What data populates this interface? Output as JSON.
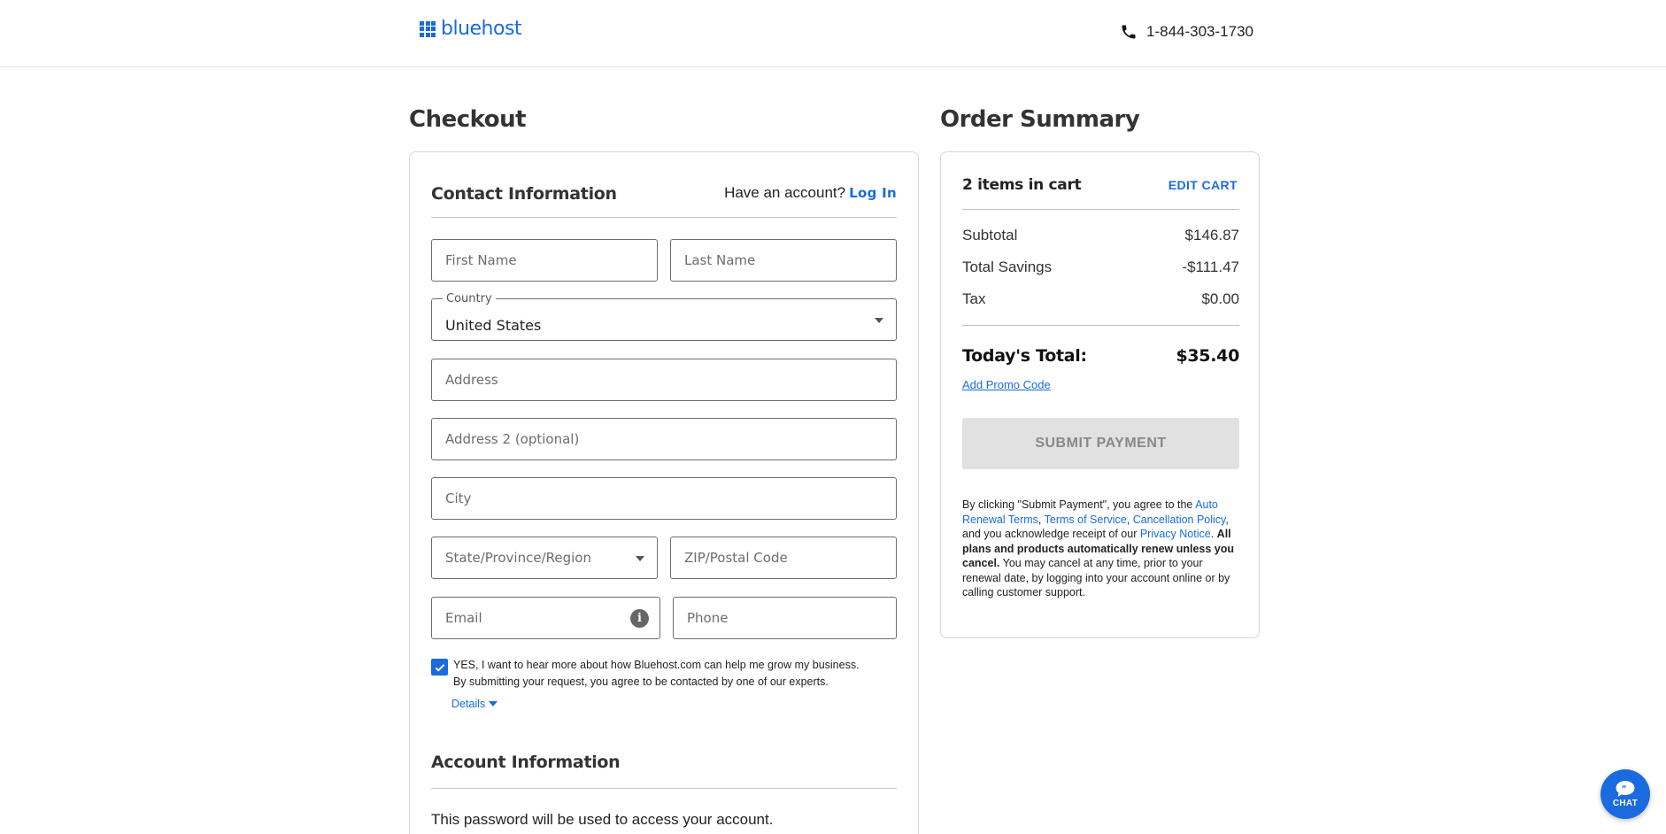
{
  "header": {
    "logo_text": "bluehost",
    "phone": "1-844-303-1730"
  },
  "checkout": {
    "title": "Checkout",
    "contact": {
      "title": "Contact Information",
      "have_account": "Have an account?",
      "login_label": "Log In"
    },
    "fields": {
      "first_name": "First Name",
      "last_name": "Last Name",
      "country_label": "Country",
      "country_value": "United States",
      "address": "Address",
      "address2": "Address 2 (optional)",
      "city": "City",
      "state": "State/Province/Region",
      "zip": "ZIP/Postal Code",
      "email": "Email",
      "phone": "Phone"
    },
    "consent": {
      "line1": "YES, I want to hear more about how Bluehost.com can help me grow my business.",
      "line2": "By submitting your request, you agree to be contacted by one of our experts.",
      "details_label": "Details"
    },
    "account": {
      "title": "Account Information",
      "password_note": "This password will be used to access your account."
    }
  },
  "summary": {
    "title": "Order Summary",
    "cart_count": "2 items in cart",
    "edit_cart": "EDIT CART",
    "rows": [
      {
        "label": "Subtotal",
        "value": "$146.87"
      },
      {
        "label": "Total Savings",
        "value": "-$111.47"
      },
      {
        "label": "Tax",
        "value": "$0.00"
      }
    ],
    "total_label": "Today's Total:",
    "total_value": "$35.40",
    "promo_label": "Add Promo Code",
    "submit_label": "SUBMIT PAYMENT",
    "legal": {
      "p1": "By clicking \"Submit Payment\", you agree to the ",
      "auto_renewal": "Auto Renewal Terms",
      "comma1": ", ",
      "tos": "Terms of Service",
      "comma2": ", ",
      "cancellation": "Cancellation Policy",
      "p2": ", and you acknowledge receipt of our ",
      "privacy": "Privacy Notice",
      "p3": ". ",
      "bold": "All plans and products automatically renew unless you cancel.",
      "p4": " You may cancel at any time, prior to your renewal date, by logging into your account online or by calling customer support."
    }
  },
  "chat": {
    "label": "CHAT"
  },
  "colors": {
    "brand": "#196bde",
    "disabled_button": "#e1e1e1"
  }
}
